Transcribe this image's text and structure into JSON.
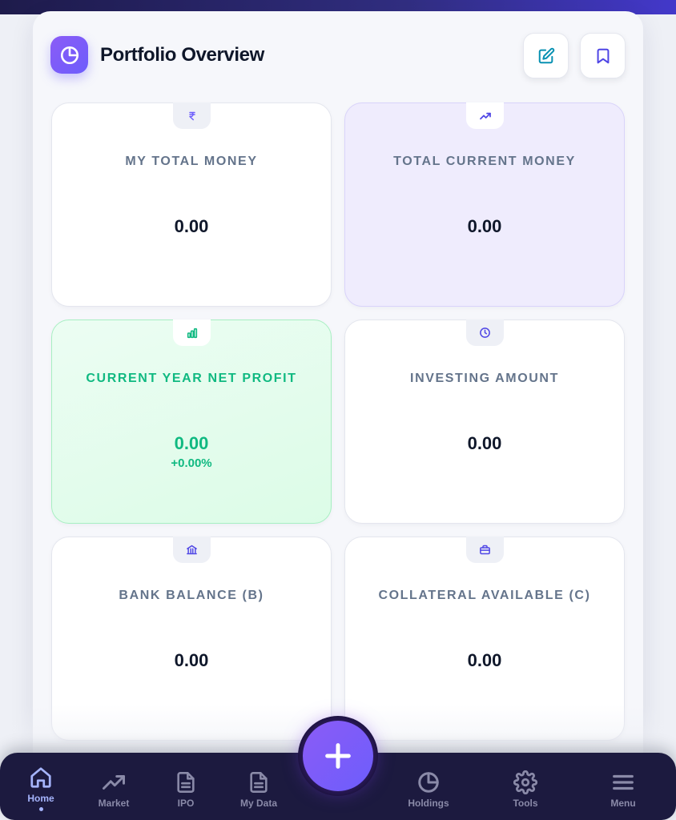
{
  "header": {
    "title": "Portfolio Overview",
    "logo_icon": "pie-chart-icon",
    "actions": [
      {
        "name": "edit-button",
        "icon": "pencil-icon"
      },
      {
        "name": "bookmark-button",
        "icon": "bookmark-icon"
      }
    ]
  },
  "cards": [
    {
      "label": "MY TOTAL MONEY",
      "value": "0.00",
      "icon": "rupee-icon"
    },
    {
      "label": "TOTAL CURRENT MONEY",
      "value": "0.00",
      "icon": "trending-up-icon"
    },
    {
      "label": "CURRENT YEAR NET PROFIT",
      "value": "0.00",
      "sub": "+0.00%",
      "icon": "bar-chart-icon"
    },
    {
      "label": "INVESTING AMOUNT",
      "value": "0.00",
      "icon": "clock-icon"
    },
    {
      "label": "BANK BALANCE (B)",
      "value": "0.00",
      "icon": "bank-icon"
    },
    {
      "label": "COLLATERAL AVAILABLE (C)",
      "value": "0.00",
      "icon": "briefcase-icon"
    }
  ],
  "nav": {
    "items": [
      {
        "label": "Home",
        "icon": "home-icon",
        "active": true
      },
      {
        "label": "Market",
        "icon": "trending-up-icon"
      },
      {
        "label": "IPO",
        "icon": "document-icon"
      },
      {
        "label": "My Data",
        "icon": "document-icon"
      },
      {
        "label": "Holdings",
        "icon": "pie-chart-icon"
      },
      {
        "label": "Tools",
        "icon": "gear-icon"
      },
      {
        "label": "Menu",
        "icon": "menu-icon"
      }
    ],
    "fab_icon": "plus-icon"
  },
  "colors": {
    "accent": "#6d5dfc",
    "profit_green": "#10b981",
    "nav_bg": "#1c1a3f",
    "title": "#0f172a",
    "label_gray": "#64748b"
  }
}
